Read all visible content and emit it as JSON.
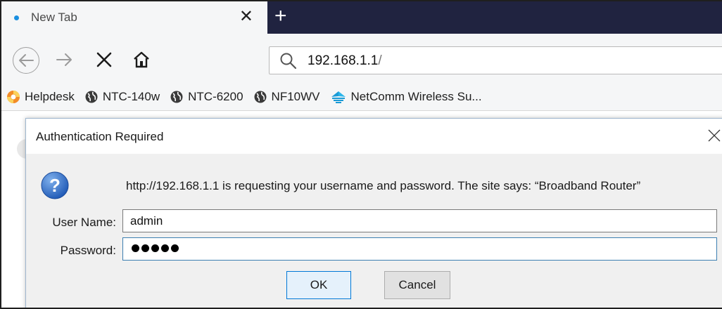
{
  "tab": {
    "title": "New Tab",
    "close_glyph": "✕",
    "newtab_glyph": "+"
  },
  "nav": {
    "back_icon": "back-arrow-icon",
    "forward_icon": "forward-arrow-icon",
    "stop_icon": "stop-icon",
    "home_icon": "home-icon"
  },
  "urlbar": {
    "host": "192.168.1.1",
    "path": "/"
  },
  "bookmarks": [
    {
      "label": "Helpdesk",
      "icon": "lifebuoy-icon"
    },
    {
      "label": "NTC-140w",
      "icon": "globe-icon"
    },
    {
      "label": "NTC-6200",
      "icon": "globe-icon"
    },
    {
      "label": "NF10WV",
      "icon": "globe-icon"
    },
    {
      "label": "NetComm Wireless Su...",
      "icon": "netcomm-icon"
    }
  ],
  "dialog": {
    "title": "Authentication Required",
    "message": "http://192.168.1.1 is requesting your username and password. The site says: “Broadband Router”",
    "username_label": "User Name:",
    "username_value": "admin",
    "password_label": "Password:",
    "password_length": 5,
    "ok_label": "OK",
    "cancel_label": "Cancel"
  },
  "colors": {
    "tabstrip": "#202340",
    "chrome": "#f5f6f7",
    "tab_dot": "#1a8fe0",
    "focus_border": "#3c7fb1",
    "ok_button_border": "#0078d7"
  }
}
